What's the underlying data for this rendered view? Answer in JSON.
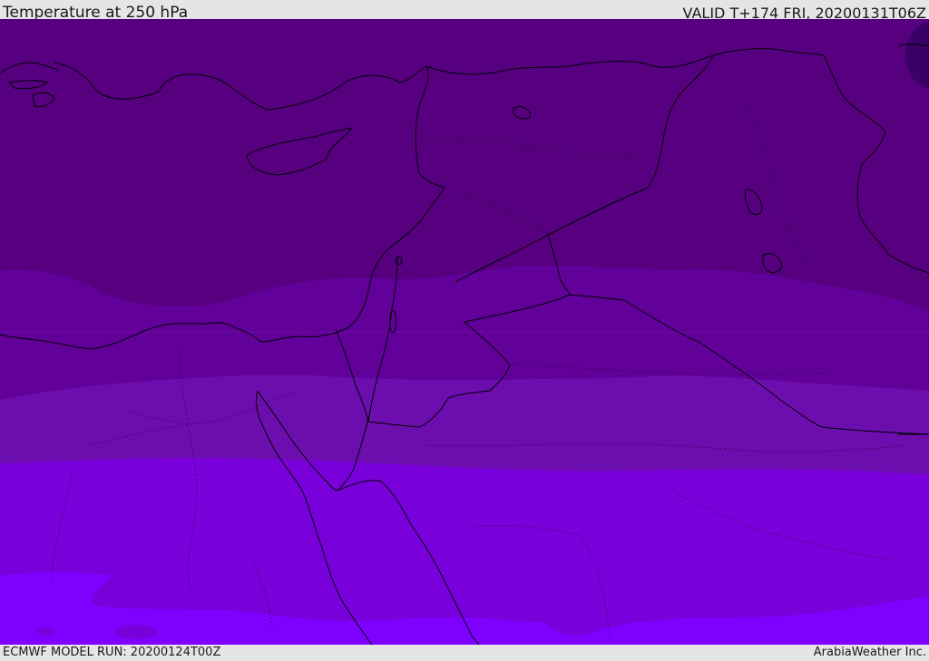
{
  "header": {
    "title": "Temperature at 250 hPa",
    "valid": "VALID T+174 FRI, 20200131T06Z"
  },
  "footer": {
    "model_run": "ECMWF MODEL RUN: 20200124T00Z",
    "credit": "ArabiaWeather Inc."
  },
  "map": {
    "field": "temperature",
    "level": "250 hPa",
    "colors": {
      "band_darkest": "#3a0066",
      "band_1": "#560080",
      "band_2": "#62009a",
      "band_3": "#6c0eae",
      "band_4": "#7a00db",
      "band_5": "#8000ff",
      "outline": "#000000"
    }
  }
}
